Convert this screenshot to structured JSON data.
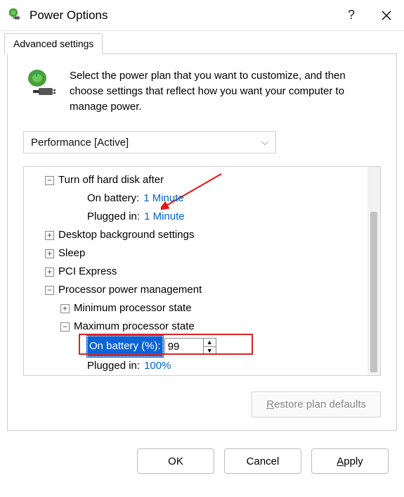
{
  "titlebar": {
    "title": "Power Options"
  },
  "tab": {
    "label": "Advanced settings"
  },
  "intro": "Select the power plan that you want to customize, and then choose settings that reflect how you want your computer to manage power.",
  "plan": {
    "selected": "Performance [Active]"
  },
  "tree": {
    "turn_off_hd": {
      "label": "Turn off hard disk after",
      "on_battery_label": "On battery:",
      "on_battery_value": "1 Minute",
      "plugged_label": "Plugged in:",
      "plugged_value": "1 Minute"
    },
    "desktop_bg": "Desktop background settings",
    "sleep": "Sleep",
    "pci": "PCI Express",
    "proc": {
      "label": "Processor power management",
      "min": "Minimum processor state",
      "max": {
        "label": "Maximum processor state",
        "on_battery_label": "On battery (%):",
        "on_battery_value": "99",
        "plugged_label": "Plugged in:",
        "plugged_value": "100%"
      }
    }
  },
  "restore": {
    "prefix": "R",
    "rest": "estore plan defaults"
  },
  "buttons": {
    "ok": "OK",
    "cancel": "Cancel",
    "apply_prefix": "A",
    "apply_rest": "pply"
  }
}
